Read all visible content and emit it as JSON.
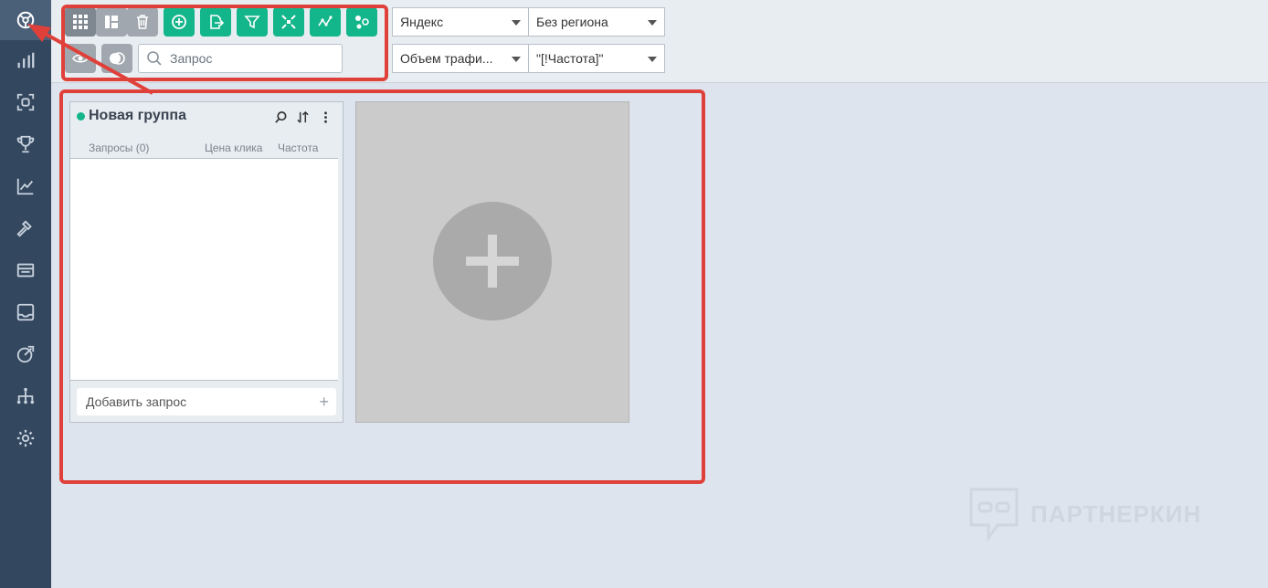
{
  "sidebar": {
    "items": [
      {
        "icon": "network-icon",
        "active": true
      },
      {
        "icon": "bar-chart-icon"
      },
      {
        "icon": "scan-icon"
      },
      {
        "icon": "trophy-icon"
      },
      {
        "icon": "line-chart-icon"
      },
      {
        "icon": "hammer-icon"
      },
      {
        "icon": "cards-icon"
      },
      {
        "icon": "inbox-icon"
      },
      {
        "icon": "pie-target-icon"
      },
      {
        "icon": "sitemap-icon"
      },
      {
        "icon": "gear-icon"
      }
    ]
  },
  "toolbar": {
    "buttons_row1": [
      {
        "icon": "grid-icon",
        "style": "dark"
      },
      {
        "icon": "layout-icon",
        "style": "gray"
      },
      {
        "icon": "trash-icon",
        "style": "gray"
      },
      {
        "icon": "plus-circle-icon",
        "style": "green"
      },
      {
        "icon": "export-icon",
        "style": "green"
      },
      {
        "icon": "filter-icon",
        "style": "green"
      },
      {
        "icon": "collapse-icon",
        "style": "green"
      },
      {
        "icon": "graph-icon",
        "style": "green"
      },
      {
        "icon": "cluster-icon",
        "style": "green"
      }
    ],
    "buttons_row2": [
      {
        "icon": "eye-icon",
        "style": "gray"
      },
      {
        "icon": "toggle-icon",
        "style": "gray"
      }
    ],
    "search": {
      "placeholder": "Запрос"
    }
  },
  "selects": {
    "engine": "Яндекс",
    "region": "Без региона",
    "metric": "Объем трафи...",
    "frequency": "\"[!Частота]\""
  },
  "group": {
    "title": "Новая группа",
    "columns": {
      "queries": "Запросы (0)",
      "click_price": "Цена клика",
      "frequency": "Частота"
    },
    "add_query": "Добавить запрос",
    "add_symbol": "+"
  },
  "watermark": {
    "text": "ПАРТНЕРКИН"
  },
  "colors": {
    "sidebar": "#33475f",
    "accent": "#13b58a",
    "annotation": "#e0403a"
  }
}
